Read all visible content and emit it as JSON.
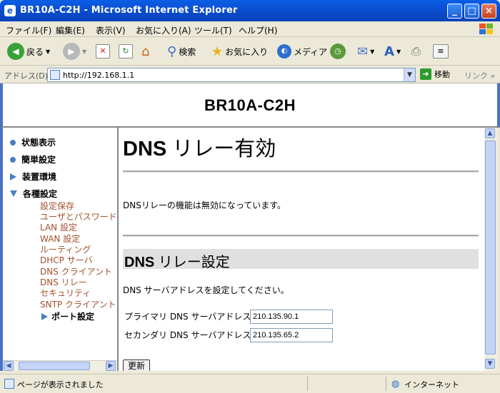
{
  "window": {
    "title": "BR10A-C2H - Microsoft Internet Explorer"
  },
  "menu": [
    "ファイル(F)",
    "編集(E)",
    "表示(V)",
    "お気に入り(A)",
    "ツール(T)",
    "ヘルプ(H)"
  ],
  "toolbar": {
    "back": "戻る",
    "search": "検索",
    "favorites": "お気に入り",
    "media": "メディア"
  },
  "address": {
    "label": "アドレス(D)",
    "url": "http://192.168.1.1",
    "go": "移動",
    "links": "リンク"
  },
  "header": {
    "brand": "BR10A-C2H"
  },
  "sidebar": {
    "items": [
      {
        "label": "状態表示"
      },
      {
        "label": "簡単設定"
      },
      {
        "label": "装置環境"
      },
      {
        "label": "各種設定"
      }
    ],
    "subitems": [
      "設定保存",
      "ユーザとパスワード",
      "LAN 設定",
      "WAN 設定",
      "ルーティング",
      "DHCP サーバ",
      "DNS クライアント",
      "DNS リレー",
      "セキュリティ",
      "SNTP クライアント"
    ],
    "port": "ポート設定"
  },
  "main": {
    "title_en": "DNS",
    "title_jp": " リレー有効",
    "status_text": "DNSリレーの機能は無効になっています。",
    "section_en": "DNS",
    "section_jp": " リレー設定",
    "instruction": "DNS サーバアドレスを設定してください。",
    "primary_label": "プライマリ DNS サーバアドレス",
    "primary_value": "210.135.90.1",
    "secondary_label": "セカンダリ DNS サーバアドレス",
    "secondary_value": "210.135.65.2",
    "update_button": "更新"
  },
  "status": {
    "message": "ページが表示されました",
    "zone": "インターネット"
  }
}
